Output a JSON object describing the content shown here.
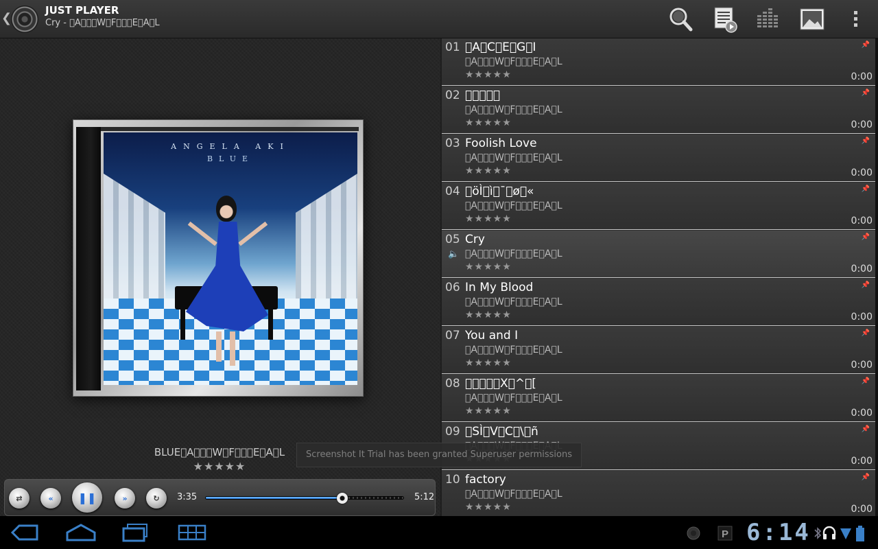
{
  "app": {
    "title": "JUST PLAYER",
    "subtitle": "Cry - \u0000A\u0000\u0000\u0000W\u0000F\u0000\u0000\u0000E\u0000A\u0000L"
  },
  "actionbar": {
    "icons": [
      "search-icon",
      "playlist-icon",
      "equalizer-icon",
      "picture-icon",
      "overflow-menu-icon"
    ]
  },
  "cover": {
    "artist_text": "ANGELA AKI",
    "album_text": "BLUE"
  },
  "now_playing": {
    "caption": "BLUE\u0000A\u0000\u0000\u0000W\u0000F\u0000\u0000\u0000E\u0000A\u0000L",
    "rating_stars": "★★★★★",
    "elapsed": "3:35",
    "total": "5:12",
    "progress": 0.69
  },
  "toast": {
    "text": "Screenshot It Trial has been granted Superuser permissions"
  },
  "tracks": [
    {
      "num": "01",
      "title": "\u0000A\u0000C\u0000E\u0000G\u0000I",
      "artist": "\u0000A\u0000\u0000\u0000W\u0000F\u0000\u0000\u0000E\u0000A\u0000L",
      "stars": "★★★★★",
      "duration": "0:00",
      "playing": false
    },
    {
      "num": "02",
      "title": "\u0000\u0000\u0000\u0000\u0000",
      "artist": "\u0000A\u0000\u0000\u0000W\u0000F\u0000\u0000\u0000E\u0000A\u0000L",
      "stars": "★★★★★",
      "duration": "0:00",
      "playing": false
    },
    {
      "num": "03",
      "title": "Foolish Love",
      "artist": "\u0000A\u0000\u0000\u0000W\u0000F\u0000\u0000\u0000E\u0000A\u0000L",
      "stars": "★★★★★",
      "duration": "0:00",
      "playing": false
    },
    {
      "num": "04",
      "title": "\u0000öÌ\u0000ì\u0000¯\u0000ø\u0000«",
      "artist": "\u0000A\u0000\u0000\u0000W\u0000F\u0000\u0000\u0000E\u0000A\u0000L",
      "stars": "★★★★★",
      "duration": "0:00",
      "playing": false
    },
    {
      "num": "05",
      "title": "Cry",
      "artist": "\u0000A\u0000\u0000\u0000W\u0000F\u0000\u0000\u0000E\u0000A\u0000L",
      "stars": "★★★★★",
      "duration": "0:00",
      "playing": true
    },
    {
      "num": "06",
      "title": "In My Blood",
      "artist": "\u0000A\u0000\u0000\u0000W\u0000F\u0000\u0000\u0000E\u0000A\u0000L",
      "stars": "★★★★★",
      "duration": "0:00",
      "playing": false
    },
    {
      "num": "07",
      "title": "You and I",
      "artist": "\u0000A\u0000\u0000\u0000W\u0000F\u0000\u0000\u0000E\u0000A\u0000L",
      "stars": "★★★★★",
      "duration": "0:00",
      "playing": false
    },
    {
      "num": "08",
      "title": "\u0000\u0000\u0000\u0000\u0000X\u0000^\u0000[",
      "artist": "\u0000A\u0000\u0000\u0000W\u0000F\u0000\u0000\u0000E\u0000A\u0000L",
      "stars": "★★★★★",
      "duration": "0:00",
      "playing": false
    },
    {
      "num": "09",
      "title": "\u0000SÌ\u0000V\u0000C\u0000\\\u0000ñ",
      "artist": "\u0000A\u0000\u0000\u0000W\u0000F\u0000\u0000\u0000E\u0000A\u0000L",
      "stars": "★★★★★",
      "duration": "0:00",
      "playing": false
    },
    {
      "num": "10",
      "title": "factory",
      "artist": "\u0000A\u0000\u0000\u0000W\u0000F\u0000\u0000\u0000E\u0000A\u0000L",
      "stars": "★★★★★",
      "duration": "0:00",
      "playing": false
    }
  ],
  "system": {
    "clock": "6:14",
    "icons": [
      "back-nav-icon",
      "home-nav-icon",
      "recent-apps-icon",
      "screenshot-icon",
      "notification-icon",
      "p-icon",
      "bluetooth-icon",
      "headset-icon",
      "wifi-icon",
      "battery-icon"
    ]
  },
  "colors": {
    "accent": "#2b78d8",
    "clock": "#9ab8d6"
  }
}
